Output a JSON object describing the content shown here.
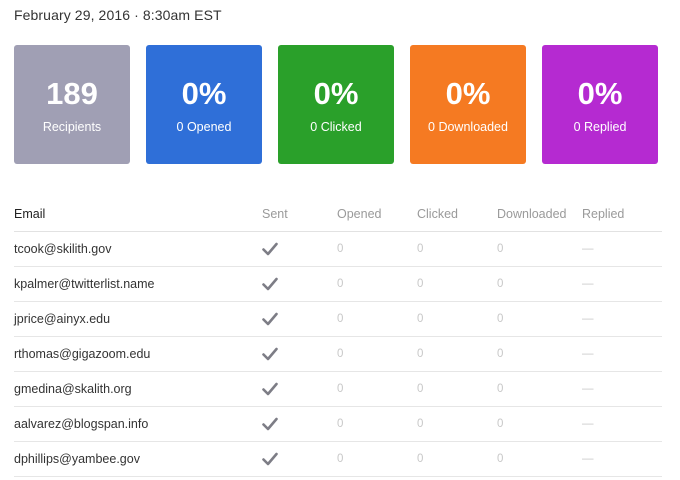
{
  "header": {
    "date": "February 29, 2016 · 8:30am EST"
  },
  "cards": [
    {
      "value": "189",
      "label": "Recipients",
      "color": "#a09fb4"
    },
    {
      "value": "0%",
      "label": "0 Opened",
      "color": "#2f6fd8"
    },
    {
      "value": "0%",
      "label": "0 Clicked",
      "color": "#2aa02a"
    },
    {
      "value": "0%",
      "label": "0 Downloaded",
      "color": "#f57a22"
    },
    {
      "value": "0%",
      "label": "0 Replied",
      "color": "#b52ad1"
    }
  ],
  "table": {
    "columns": [
      "Email",
      "Sent",
      "Opened",
      "Clicked",
      "Downloaded",
      "Replied"
    ],
    "rows": [
      {
        "email": "tcook@skilith.gov",
        "sent": "check-icon",
        "opened": "0",
        "clicked": "0",
        "downloaded": "0",
        "replied": "—"
      },
      {
        "email": "kpalmer@twitterlist.name",
        "sent": "check-icon",
        "opened": "0",
        "clicked": "0",
        "downloaded": "0",
        "replied": "—"
      },
      {
        "email": "jprice@ainyx.edu",
        "sent": "check-icon",
        "opened": "0",
        "clicked": "0",
        "downloaded": "0",
        "replied": "—"
      },
      {
        "email": "rthomas@gigazoom.edu",
        "sent": "check-icon",
        "opened": "0",
        "clicked": "0",
        "downloaded": "0",
        "replied": "—"
      },
      {
        "email": "gmedina@skalith.org",
        "sent": "check-icon",
        "opened": "0",
        "clicked": "0",
        "downloaded": "0",
        "replied": "—"
      },
      {
        "email": "aalvarez@blogspan.info",
        "sent": "check-icon",
        "opened": "0",
        "clicked": "0",
        "downloaded": "0",
        "replied": "—"
      },
      {
        "email": "dphillips@yambee.gov",
        "sent": "check-icon",
        "opened": "0",
        "clicked": "0",
        "downloaded": "0",
        "replied": "—"
      }
    ]
  }
}
